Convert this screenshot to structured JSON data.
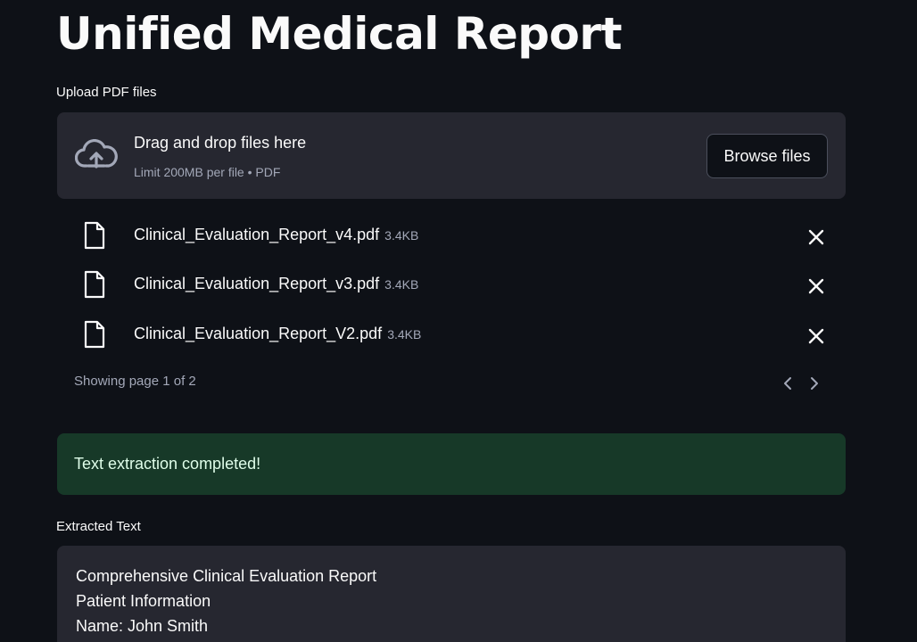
{
  "title": "Unified Medical Report",
  "uploader": {
    "label": "Upload PDF files",
    "drop_text": "Drag and drop files here",
    "limit_text": "Limit 200MB per file • PDF",
    "browse_label": "Browse files",
    "files": [
      {
        "name": "Clinical_Evaluation_Report_v4.pdf",
        "size": "3.4KB"
      },
      {
        "name": "Clinical_Evaluation_Report_v3.pdf",
        "size": "3.4KB"
      },
      {
        "name": "Clinical_Evaluation_Report_V2.pdf",
        "size": "3.4KB"
      }
    ],
    "pagination": "Showing page 1 of 2"
  },
  "alert": {
    "text": "Text extraction completed!"
  },
  "extracted": {
    "label": "Extracted Text",
    "lines": [
      "Comprehensive Clinical Evaluation Report",
      "Patient Information",
      "Name: John Smith"
    ]
  },
  "colors": {
    "background": "#0e1117",
    "panel": "#262730",
    "success_bg": "#173928",
    "success_text": "#dffde9",
    "muted_text": "#a3a8b8"
  },
  "icons": {
    "upload": "cloud-upload-icon",
    "file": "file-icon",
    "remove": "close-icon",
    "prev": "chevron-left-icon",
    "next": "chevron-right-icon"
  }
}
